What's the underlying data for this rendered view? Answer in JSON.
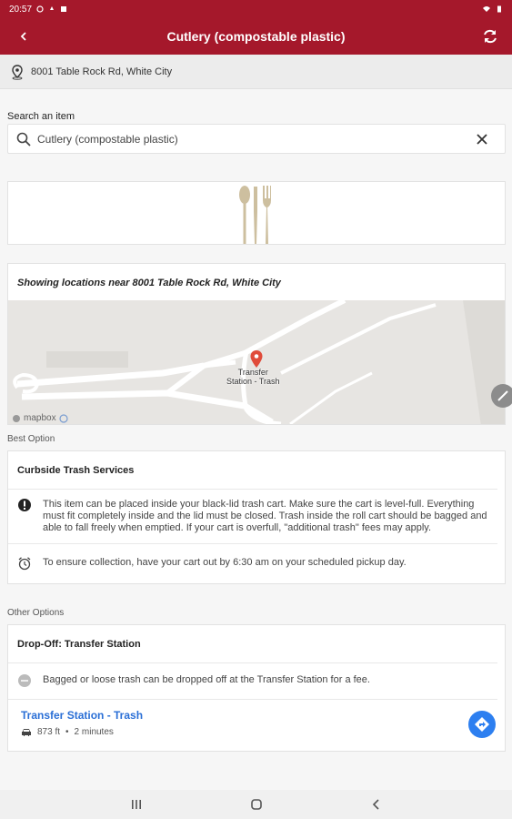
{
  "status_bar": {
    "time": "20:57"
  },
  "app_bar": {
    "title": "Cutlery (compostable plastic)"
  },
  "address": {
    "text": "8001 Table Rock Rd, White City"
  },
  "search": {
    "label": "Search an item",
    "value": "Cutlery (compostable plastic)"
  },
  "map": {
    "near_text": "Showing locations near 8001 Table Rock Rd, White City",
    "marker_label_line1": "Transfer",
    "marker_label_line2": "Station - Trash",
    "attribution": "mapbox"
  },
  "best": {
    "section_label": "Best Option",
    "title": "Curbside Trash Services",
    "info_text": "This item can be placed inside your black-lid trash cart. Make sure the cart is level-full. Everything must fit completely inside and the lid must be closed. Trash inside the roll cart should be bagged and able to fall freely when emptied. If your cart is overfull, \"additional trash\" fees may apply.",
    "time_text": "To ensure collection, have your cart out by 6:30 am on your scheduled pickup day."
  },
  "other": {
    "section_label": "Other Options",
    "title": "Drop-Off: Transfer Station",
    "info_text": "Bagged or loose trash can be dropped off at the Transfer Station for a fee.",
    "location_name": "Transfer Station - Trash",
    "distance": "873 ft",
    "separator": "•",
    "duration": "2 minutes"
  },
  "colors": {
    "brand": "#a5182b",
    "link": "#2a6fd6",
    "directions": "#2d7ff0"
  },
  "icons": [
    "back-arrow-icon",
    "refresh-icon",
    "location-pin-icon",
    "search-icon",
    "close-icon",
    "cutlery-icon",
    "map-marker-icon",
    "info-icon",
    "alarm-clock-icon",
    "car-icon",
    "directions-icon"
  ]
}
